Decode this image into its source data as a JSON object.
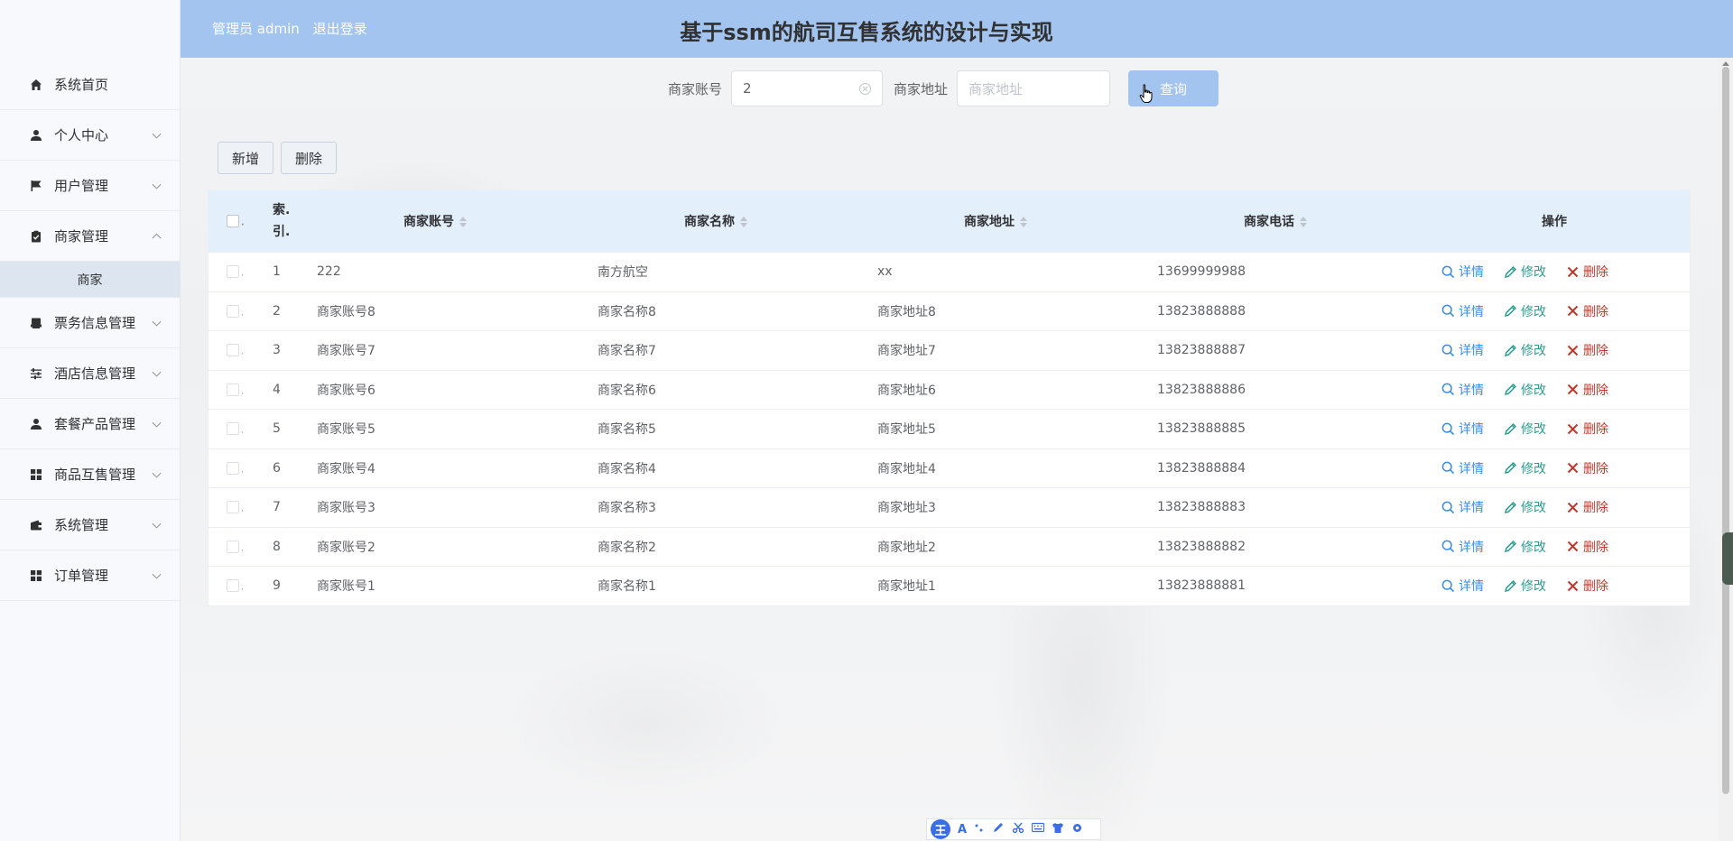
{
  "header": {
    "user_label": "管理员 admin",
    "logout_label": "退出登录",
    "title": "基于ssm的航司互售系统的设计与实现"
  },
  "sidebar": {
    "items": [
      {
        "label": "系统首页",
        "icon": "home-icon"
      },
      {
        "label": "个人中心",
        "icon": "person-icon"
      },
      {
        "label": "用户管理",
        "icon": "flag-icon"
      },
      {
        "label": "商家管理",
        "icon": "clipboard-icon"
      },
      {
        "label": "票务信息管理",
        "icon": "printer-icon"
      },
      {
        "label": "酒店信息管理",
        "icon": "sliders-icon"
      },
      {
        "label": "套餐产品管理",
        "icon": "person-icon"
      },
      {
        "label": "商品互售管理",
        "icon": "grid-icon"
      },
      {
        "label": "系统管理",
        "icon": "wallet-icon"
      },
      {
        "label": "订单管理",
        "icon": "grid-icon"
      }
    ],
    "submenu": {
      "label": "商家"
    }
  },
  "search": {
    "account_label": "商家账号",
    "account_value": "2",
    "address_label": "商家地址",
    "address_placeholder": "商家地址",
    "query_label": "查询"
  },
  "toolbar": {
    "add_label": "新增",
    "delete_label": "删除"
  },
  "table": {
    "headers": {
      "index": "索.",
      "index2": "引.",
      "account": "商家账号",
      "name": "商家名称",
      "address": "商家地址",
      "phone": "商家电话",
      "ops": "操作"
    },
    "op_labels": {
      "detail": "详情",
      "edit": "修改",
      "delete": "删除"
    },
    "rows": [
      {
        "idx": "1",
        "account": "222",
        "name": "南方航空",
        "address": "xx",
        "phone": "13699999988"
      },
      {
        "idx": "2",
        "account": "商家账号8",
        "name": "商家名称8",
        "address": "商家地址8",
        "phone": "13823888888"
      },
      {
        "idx": "3",
        "account": "商家账号7",
        "name": "商家名称7",
        "address": "商家地址7",
        "phone": "13823888887"
      },
      {
        "idx": "4",
        "account": "商家账号6",
        "name": "商家名称6",
        "address": "商家地址6",
        "phone": "13823888886"
      },
      {
        "idx": "5",
        "account": "商家账号5",
        "name": "商家名称5",
        "address": "商家地址5",
        "phone": "13823888885"
      },
      {
        "idx": "6",
        "account": "商家账号4",
        "name": "商家名称4",
        "address": "商家地址4",
        "phone": "13823888884"
      },
      {
        "idx": "7",
        "account": "商家账号3",
        "name": "商家名称3",
        "address": "商家地址3",
        "phone": "13823888883"
      },
      {
        "idx": "8",
        "account": "商家账号2",
        "name": "商家名称2",
        "address": "商家地址2",
        "phone": "13823888882"
      },
      {
        "idx": "9",
        "account": "商家账号1",
        "name": "商家名称1",
        "address": "商家地址1",
        "phone": "13823888881"
      }
    ]
  },
  "ime_toolbar": {
    "logo": "王",
    "font_glyph": "A"
  },
  "colors": {
    "header_bg": "#a3c4ef",
    "table_head_bg": "#e3effb",
    "detail": "#3a8ee6",
    "edit": "#2a9d8f",
    "delete": "#c0392b"
  }
}
